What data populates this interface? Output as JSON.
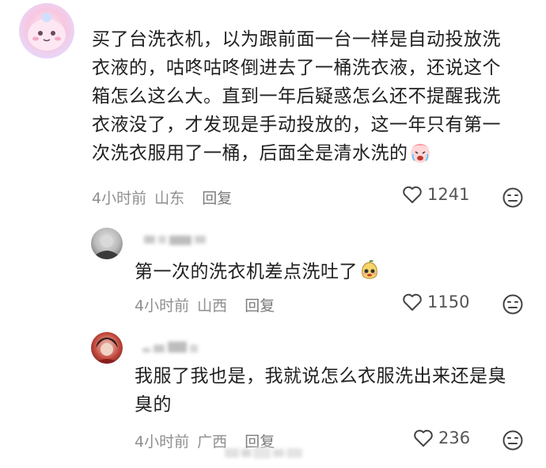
{
  "comments": [
    {
      "text": "买了台洗衣机，以为跟前面一台一样是自动投放洗衣液的，咕咚咕咚倒进去了一桶洗衣液，还说这个箱怎么这么大。直到一年后疑惑怎么还不提醒我洗衣液没了，才发现是手动投放的，这一年只有第一次洗衣服用了一桶，后面全是清水洗的",
      "time": "4小时前",
      "location": "山东",
      "reply_label": "回复",
      "likes": "1241"
    },
    {
      "text": "第一次的洗衣机差点洗吐了",
      "time": "4小时前",
      "location": "山西",
      "reply_label": "回复",
      "likes": "1150"
    },
    {
      "text": "我服了我也是，我就说怎么衣服洗出来还是臭臭的",
      "time": "4小时前",
      "location": "广西",
      "reply_label": "回复",
      "likes": "236"
    }
  ],
  "icons": {
    "like": "heart-outline-icon",
    "dislike": "meh-face-icon",
    "emoji_crying": "crying-emoji-icon",
    "emoji_pear": "pear-emoji-icon"
  },
  "colors": {
    "meta": "#8f8f8f",
    "text": "#1f1f1f",
    "avatar_pink": "#f7c7e0"
  }
}
